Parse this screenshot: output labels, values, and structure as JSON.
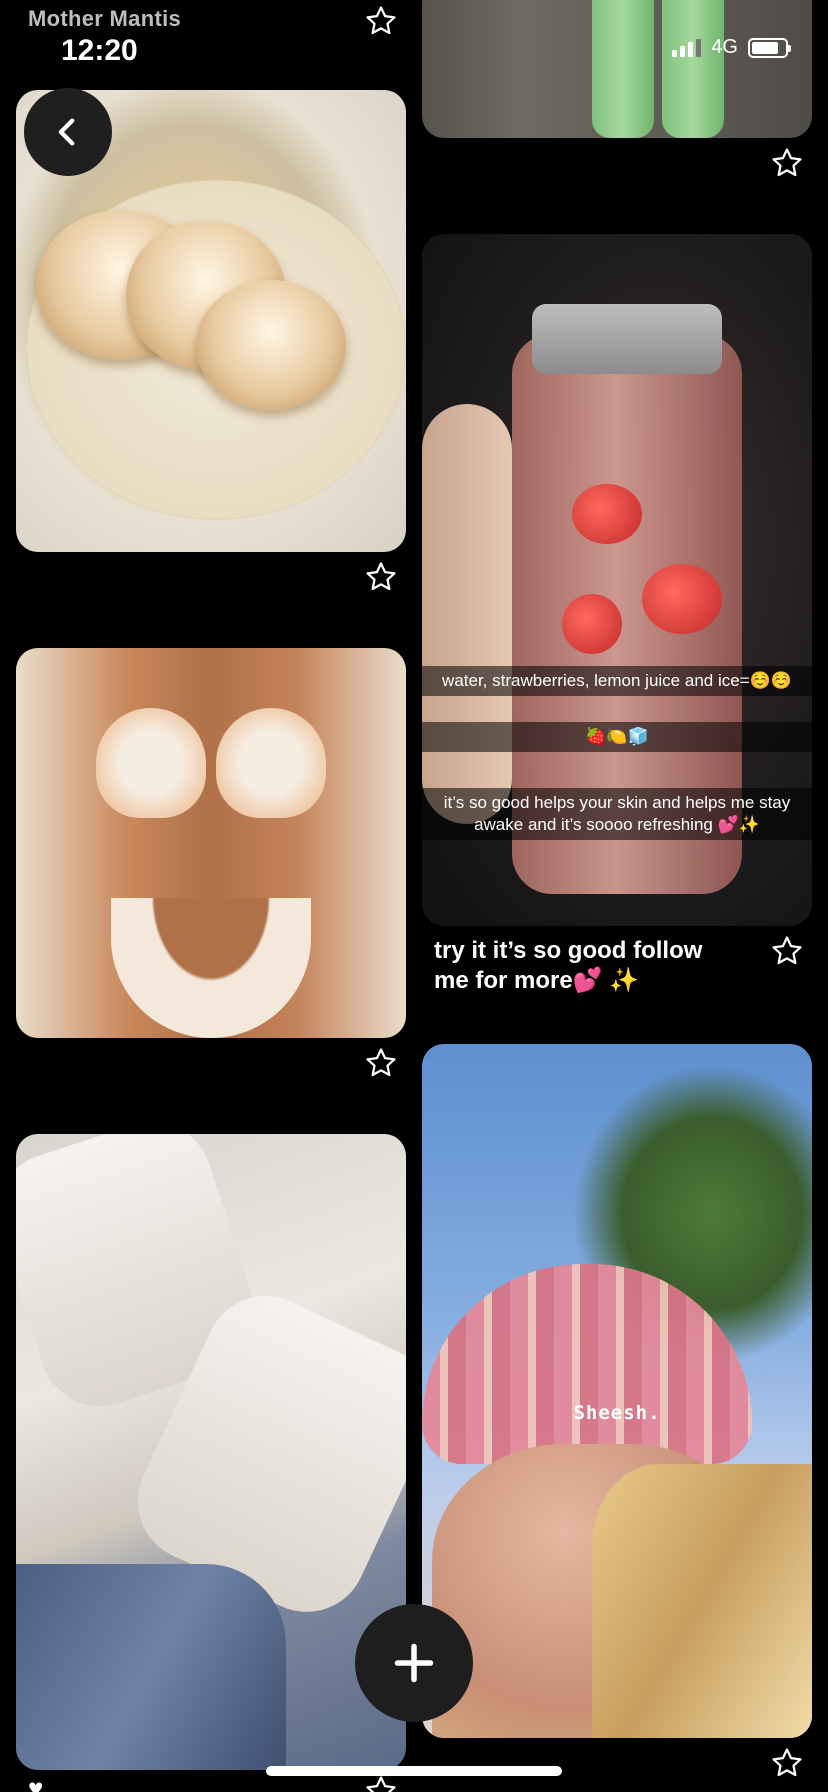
{
  "status_bar": {
    "carrier": "Mother Mantis",
    "time": "12:20",
    "network": "4G",
    "battery_level": 0.8
  },
  "navigation": {
    "back_icon": "chevron-left-icon"
  },
  "pins": [
    {
      "id": "pancakes",
      "subject": "pancakes",
      "saved": false
    },
    {
      "id": "legs",
      "subject": "green trousers",
      "saved": false
    },
    {
      "id": "bottle",
      "subject": "water bottle",
      "saved": false,
      "overlay_lines": [
        "water, strawberries, lemon juice and ice=☺️☺️",
        "🍓🍋🧊",
        "it’s so good helps your skin and helps me stay awake and it’s soooo refreshing 💕✨"
      ],
      "title": "try it it’s so good follow me for more💕 ✨"
    },
    {
      "id": "bikini",
      "subject": "floral bikini",
      "saved": false
    },
    {
      "id": "blouse",
      "subject": "white blouse",
      "saved": false
    },
    {
      "id": "hat",
      "subject": "bucket hat",
      "saved": false,
      "overlay_text": "Sheesh."
    }
  ],
  "actions": {
    "add_icon": "plus-icon",
    "save_icon": "star-outline-icon",
    "like_icon": "heart-icon"
  },
  "colors": {
    "background": "#000000",
    "text": "#ffffff",
    "carrier_text": "#bdbdbd",
    "fab_background": "#1e1e1e"
  }
}
